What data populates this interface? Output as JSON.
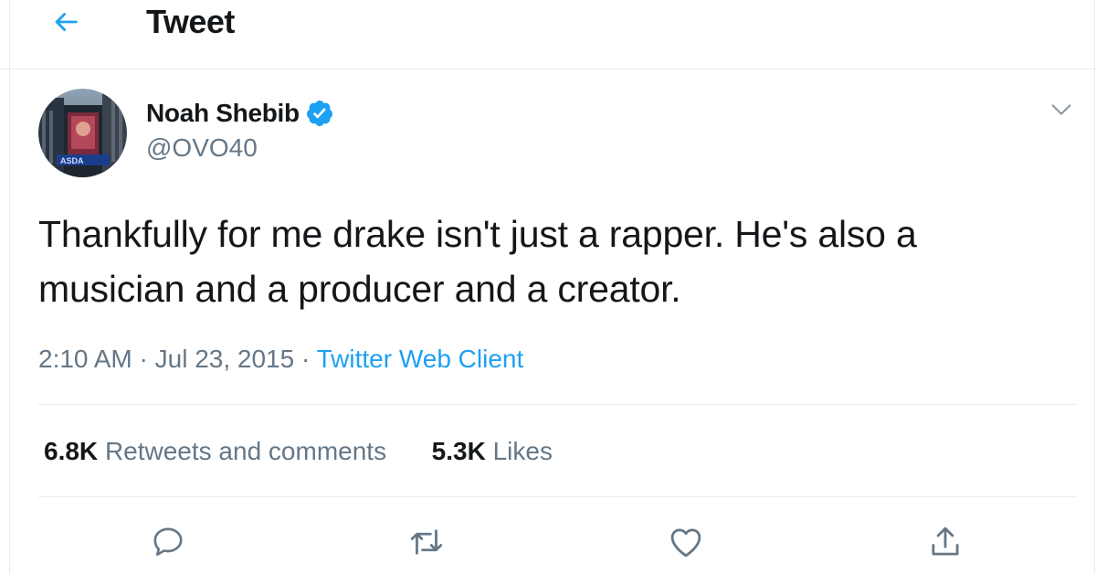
{
  "header": {
    "title": "Tweet",
    "back_icon": "arrow-left-icon",
    "accent": "#1da1f2"
  },
  "author": {
    "display_name": "Noah Shebib",
    "handle": "@OVO40",
    "verified": true,
    "avatar_icon": "avatar-image"
  },
  "tweet": {
    "text": "Thankfully for me drake isn't just a rapper. He's also a musician and a producer and a creator.",
    "time": "2:10 AM",
    "separator": "·",
    "date": "Jul 23, 2015",
    "source": "Twitter Web Client"
  },
  "stats": {
    "retweets_count": "6.8K",
    "retweets_label": "Retweets and comments",
    "likes_count": "5.3K",
    "likes_label": "Likes"
  },
  "actions": {
    "reply_icon": "reply-icon",
    "retweet_icon": "retweet-icon",
    "like_icon": "heart-icon",
    "share_icon": "share-icon"
  },
  "colors": {
    "text": "#14171a",
    "secondary": "#657786",
    "link": "#1da1f2",
    "border": "#e6ecf0"
  }
}
